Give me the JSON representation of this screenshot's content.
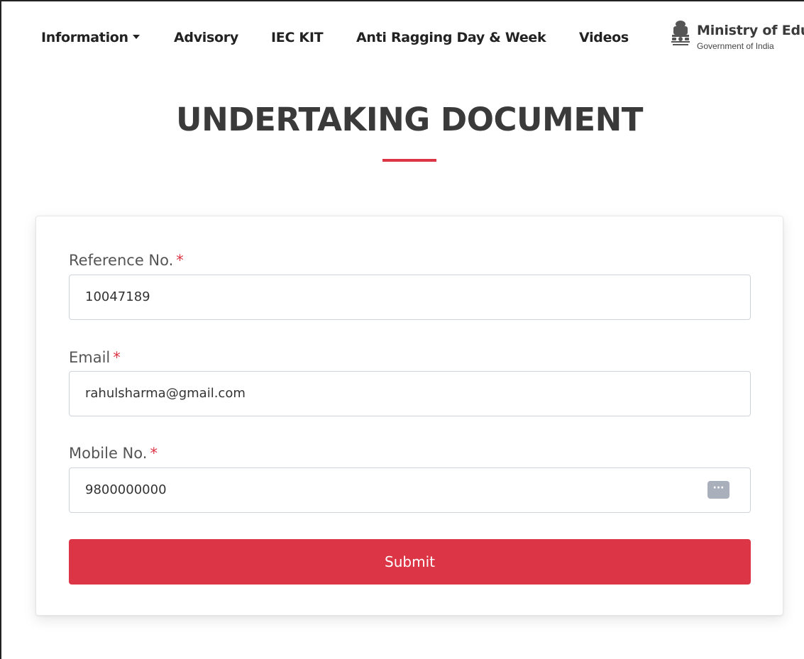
{
  "nav": {
    "items": [
      {
        "label": "Information",
        "has_dropdown": true
      },
      {
        "label": "Advisory"
      },
      {
        "label": "IEC KIT"
      },
      {
        "label": "Anti Ragging Day & Week"
      },
      {
        "label": "Videos"
      }
    ],
    "ministry": {
      "title": "Ministry of Educ",
      "subtitle": "Government of India"
    }
  },
  "page": {
    "title": "UNDERTAKING DOCUMENT"
  },
  "form": {
    "required_mark": "*",
    "reference": {
      "label": "Reference No.",
      "value": "10047189"
    },
    "email": {
      "label": "Email",
      "value": "rahulsharma@gmail.com"
    },
    "mobile": {
      "label": "Mobile No.",
      "value": "9800000000",
      "icon": "autofill-dots-icon"
    },
    "submit_label": "Submit"
  },
  "colors": {
    "accent": "#dc3545",
    "text": "#333333"
  }
}
